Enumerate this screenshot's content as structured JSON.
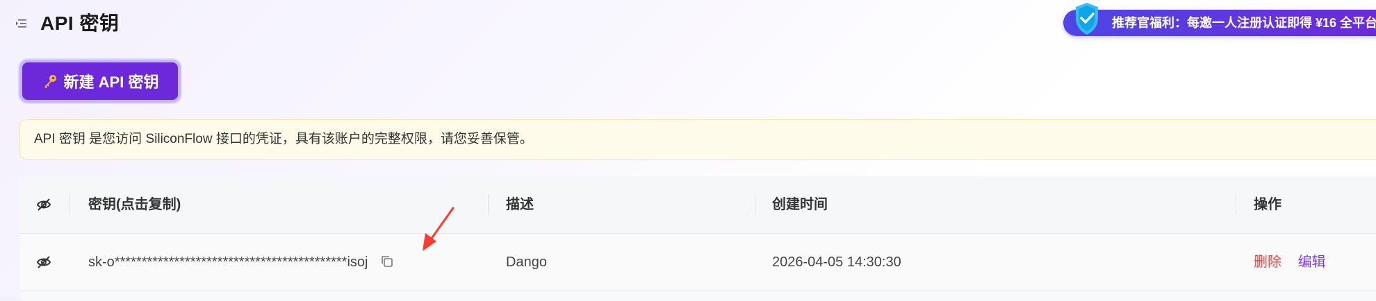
{
  "header": {
    "title": "API 密钥",
    "menu_icon": "menu-collapse-icon"
  },
  "promo": {
    "text": "推荐官福利：每邀一人注册认证即得 ¥16 全平台",
    "icon": "shield-check-icon"
  },
  "actions": {
    "new_key_label": "新建 API 密钥",
    "new_key_icon": "key-icon"
  },
  "notice": {
    "text": "API 密钥 是您访问 SiliconFlow 接口的凭证，具有该账户的完整权限，请您妥善保管。"
  },
  "table": {
    "columns": [
      "密钥(点击复制)",
      "描述",
      "创建时间",
      "操作"
    ],
    "rows": [
      {
        "key": "sk-o*******************************************isoj",
        "description": "Dango",
        "created": "2026-04-05 14:30:30",
        "delete_label": "删除",
        "edit_label": "编辑"
      }
    ]
  },
  "colors": {
    "accent": "#6d28d9",
    "notice_bg": "#fffbea",
    "delete": "#ef4444",
    "edit": "#7c3aed",
    "annotation": "#ff3b30"
  }
}
